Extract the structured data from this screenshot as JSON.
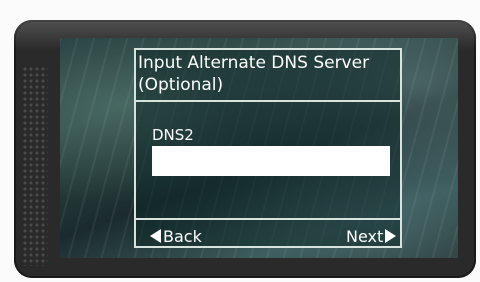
{
  "dialog": {
    "title": "Input Alternate DNS Server\n(Optional)",
    "field_label": "DNS2",
    "field_value": "",
    "back_label": "Back",
    "next_label": "Next"
  },
  "icons": {
    "back": "triangle-left",
    "next": "triangle-right"
  },
  "colors": {
    "text": "#ffffff",
    "border": "#d8e2de",
    "field_bg": "#ffffff"
  }
}
